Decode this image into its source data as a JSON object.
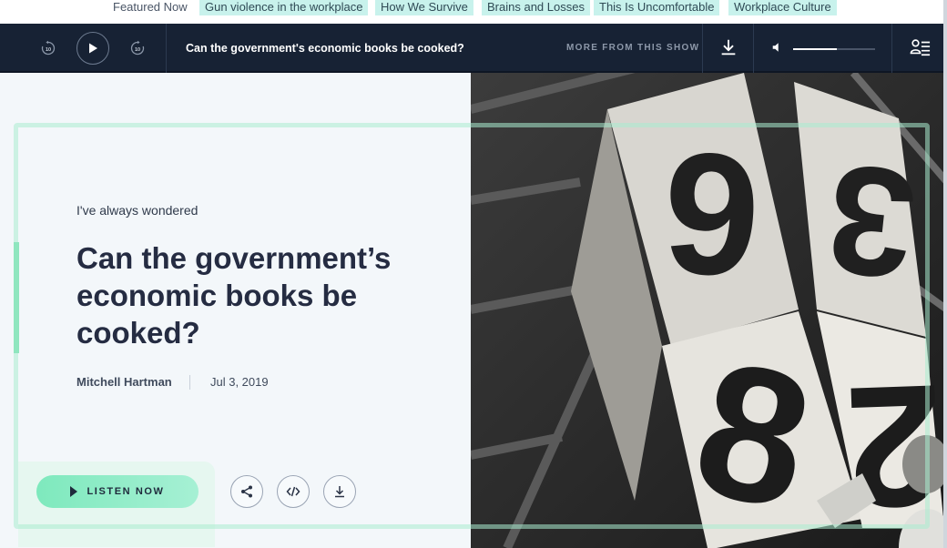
{
  "featured": {
    "label": "Featured Now",
    "chips": [
      "Gun violence in the workplace",
      "How We Survive",
      "Brains and Losses",
      "This Is Uncomfortable",
      "Workplace Culture"
    ]
  },
  "player": {
    "rewind_label": "10",
    "forward_label": "10",
    "now_playing": "Can the government's economic books be cooked?",
    "more_from_show": "MORE FROM THIS SHOW",
    "volume_level": 0.53
  },
  "article": {
    "kicker": "I've always wondered",
    "headline": "Can the government’s economic books be cooked?",
    "author": "Mitchell Hartman",
    "date": "Jul 3, 2019",
    "listen_label": "LISTEN NOW"
  },
  "colors": {
    "accent_mint": "#7ee9bd",
    "player_bg": "#172234",
    "chip_bg": "#c8f2ec",
    "headline": "#252c42"
  },
  "icons": [
    "rewind-10-icon",
    "play-icon",
    "forward-10-icon",
    "download-icon",
    "volume-icon",
    "queue-icon",
    "share-icon",
    "embed-icon"
  ]
}
